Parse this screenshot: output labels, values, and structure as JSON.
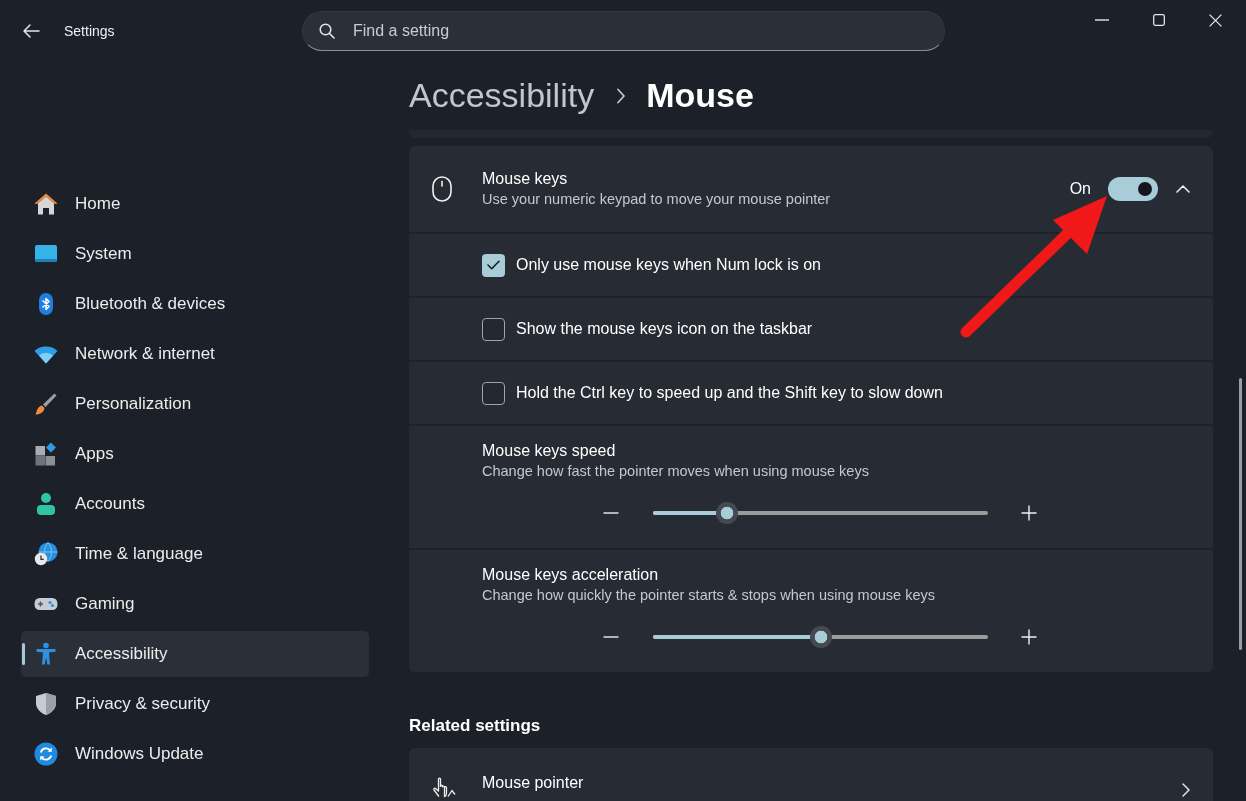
{
  "window": {
    "title": "Settings"
  },
  "search": {
    "placeholder": "Find a setting"
  },
  "sidebar": {
    "items": [
      {
        "label": "Home",
        "selected": false
      },
      {
        "label": "System",
        "selected": false
      },
      {
        "label": "Bluetooth & devices",
        "selected": false
      },
      {
        "label": "Network & internet",
        "selected": false
      },
      {
        "label": "Personalization",
        "selected": false
      },
      {
        "label": "Apps",
        "selected": false
      },
      {
        "label": "Accounts",
        "selected": false
      },
      {
        "label": "Time & language",
        "selected": false
      },
      {
        "label": "Gaming",
        "selected": false
      },
      {
        "label": "Accessibility",
        "selected": true
      },
      {
        "label": "Privacy & security",
        "selected": false
      },
      {
        "label": "Windows Update",
        "selected": false
      }
    ]
  },
  "breadcrumb": {
    "parent": "Accessibility",
    "current": "Mouse"
  },
  "mouse_keys": {
    "title": "Mouse keys",
    "description": "Use your numeric keypad to move your mouse pointer",
    "state_label": "On",
    "on": true,
    "expanded": true,
    "options": [
      {
        "kind": "checkbox",
        "label": "Only use mouse keys when Num lock is on",
        "checked": true
      },
      {
        "kind": "checkbox",
        "label": "Show the mouse keys icon on the taskbar",
        "checked": false
      },
      {
        "kind": "checkbox",
        "label": "Hold the Ctrl key to speed up and the Shift key to slow down",
        "checked": false
      },
      {
        "kind": "slider",
        "title": "Mouse keys speed",
        "description": "Change how fast the pointer moves when using mouse keys",
        "level": 0.22
      },
      {
        "kind": "slider",
        "title": "Mouse keys acceleration",
        "description": "Change how quickly the pointer starts & stops when using mouse keys",
        "level": 0.5
      }
    ]
  },
  "related_settings": {
    "heading": "Related settings",
    "items": [
      {
        "title": "Mouse pointer"
      }
    ]
  },
  "annotations": [
    {
      "kind": "arrow"
    }
  ]
}
